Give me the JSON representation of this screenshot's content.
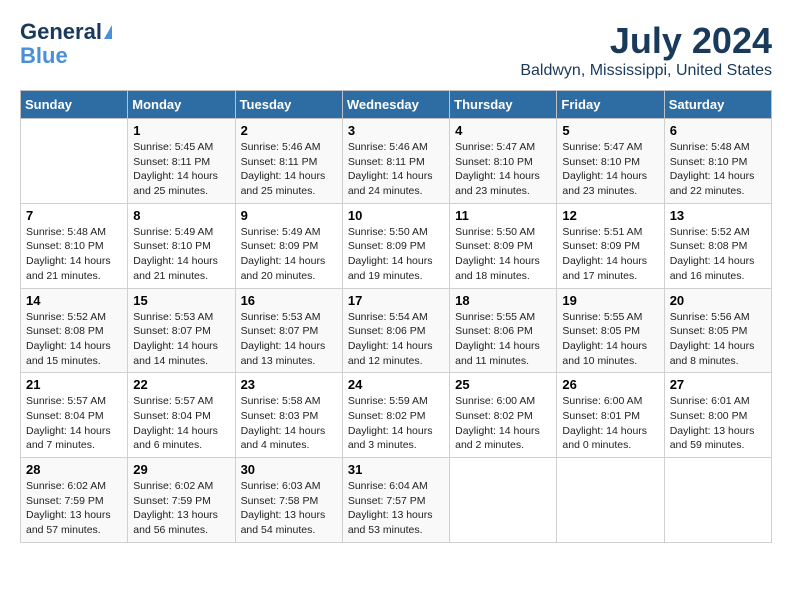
{
  "header": {
    "logo_line1": "General",
    "logo_line2": "Blue",
    "title": "July 2024",
    "subtitle": "Baldwyn, Mississippi, United States"
  },
  "days_of_week": [
    "Sunday",
    "Monday",
    "Tuesday",
    "Wednesday",
    "Thursday",
    "Friday",
    "Saturday"
  ],
  "weeks": [
    [
      {
        "day": "",
        "info": ""
      },
      {
        "day": "1",
        "info": "Sunrise: 5:45 AM\nSunset: 8:11 PM\nDaylight: 14 hours\nand 25 minutes."
      },
      {
        "day": "2",
        "info": "Sunrise: 5:46 AM\nSunset: 8:11 PM\nDaylight: 14 hours\nand 25 minutes."
      },
      {
        "day": "3",
        "info": "Sunrise: 5:46 AM\nSunset: 8:11 PM\nDaylight: 14 hours\nand 24 minutes."
      },
      {
        "day": "4",
        "info": "Sunrise: 5:47 AM\nSunset: 8:10 PM\nDaylight: 14 hours\nand 23 minutes."
      },
      {
        "day": "5",
        "info": "Sunrise: 5:47 AM\nSunset: 8:10 PM\nDaylight: 14 hours\nand 23 minutes."
      },
      {
        "day": "6",
        "info": "Sunrise: 5:48 AM\nSunset: 8:10 PM\nDaylight: 14 hours\nand 22 minutes."
      }
    ],
    [
      {
        "day": "7",
        "info": "Sunrise: 5:48 AM\nSunset: 8:10 PM\nDaylight: 14 hours\nand 21 minutes."
      },
      {
        "day": "8",
        "info": "Sunrise: 5:49 AM\nSunset: 8:10 PM\nDaylight: 14 hours\nand 21 minutes."
      },
      {
        "day": "9",
        "info": "Sunrise: 5:49 AM\nSunset: 8:09 PM\nDaylight: 14 hours\nand 20 minutes."
      },
      {
        "day": "10",
        "info": "Sunrise: 5:50 AM\nSunset: 8:09 PM\nDaylight: 14 hours\nand 19 minutes."
      },
      {
        "day": "11",
        "info": "Sunrise: 5:50 AM\nSunset: 8:09 PM\nDaylight: 14 hours\nand 18 minutes."
      },
      {
        "day": "12",
        "info": "Sunrise: 5:51 AM\nSunset: 8:09 PM\nDaylight: 14 hours\nand 17 minutes."
      },
      {
        "day": "13",
        "info": "Sunrise: 5:52 AM\nSunset: 8:08 PM\nDaylight: 14 hours\nand 16 minutes."
      }
    ],
    [
      {
        "day": "14",
        "info": "Sunrise: 5:52 AM\nSunset: 8:08 PM\nDaylight: 14 hours\nand 15 minutes."
      },
      {
        "day": "15",
        "info": "Sunrise: 5:53 AM\nSunset: 8:07 PM\nDaylight: 14 hours\nand 14 minutes."
      },
      {
        "day": "16",
        "info": "Sunrise: 5:53 AM\nSunset: 8:07 PM\nDaylight: 14 hours\nand 13 minutes."
      },
      {
        "day": "17",
        "info": "Sunrise: 5:54 AM\nSunset: 8:06 PM\nDaylight: 14 hours\nand 12 minutes."
      },
      {
        "day": "18",
        "info": "Sunrise: 5:55 AM\nSunset: 8:06 PM\nDaylight: 14 hours\nand 11 minutes."
      },
      {
        "day": "19",
        "info": "Sunrise: 5:55 AM\nSunset: 8:05 PM\nDaylight: 14 hours\nand 10 minutes."
      },
      {
        "day": "20",
        "info": "Sunrise: 5:56 AM\nSunset: 8:05 PM\nDaylight: 14 hours\nand 8 minutes."
      }
    ],
    [
      {
        "day": "21",
        "info": "Sunrise: 5:57 AM\nSunset: 8:04 PM\nDaylight: 14 hours\nand 7 minutes."
      },
      {
        "day": "22",
        "info": "Sunrise: 5:57 AM\nSunset: 8:04 PM\nDaylight: 14 hours\nand 6 minutes."
      },
      {
        "day": "23",
        "info": "Sunrise: 5:58 AM\nSunset: 8:03 PM\nDaylight: 14 hours\nand 4 minutes."
      },
      {
        "day": "24",
        "info": "Sunrise: 5:59 AM\nSunset: 8:02 PM\nDaylight: 14 hours\nand 3 minutes."
      },
      {
        "day": "25",
        "info": "Sunrise: 6:00 AM\nSunset: 8:02 PM\nDaylight: 14 hours\nand 2 minutes."
      },
      {
        "day": "26",
        "info": "Sunrise: 6:00 AM\nSunset: 8:01 PM\nDaylight: 14 hours\nand 0 minutes."
      },
      {
        "day": "27",
        "info": "Sunrise: 6:01 AM\nSunset: 8:00 PM\nDaylight: 13 hours\nand 59 minutes."
      }
    ],
    [
      {
        "day": "28",
        "info": "Sunrise: 6:02 AM\nSunset: 7:59 PM\nDaylight: 13 hours\nand 57 minutes."
      },
      {
        "day": "29",
        "info": "Sunrise: 6:02 AM\nSunset: 7:59 PM\nDaylight: 13 hours\nand 56 minutes."
      },
      {
        "day": "30",
        "info": "Sunrise: 6:03 AM\nSunset: 7:58 PM\nDaylight: 13 hours\nand 54 minutes."
      },
      {
        "day": "31",
        "info": "Sunrise: 6:04 AM\nSunset: 7:57 PM\nDaylight: 13 hours\nand 53 minutes."
      },
      {
        "day": "",
        "info": ""
      },
      {
        "day": "",
        "info": ""
      },
      {
        "day": "",
        "info": ""
      }
    ]
  ]
}
